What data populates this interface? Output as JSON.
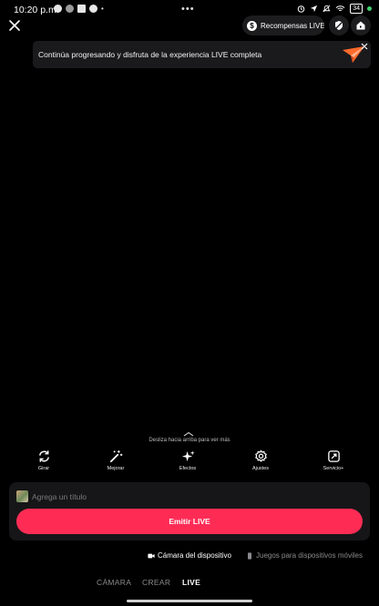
{
  "status_bar": {
    "time": "10:20 p.m.",
    "more_dots": "•••",
    "battery": "34"
  },
  "header": {
    "rewards_label": "Recompensas LIVE...",
    "coin_glyph": "$"
  },
  "banner": {
    "text": "Continúa progresando y disfruta de la experiencia LIVE completa"
  },
  "swipe_hint": "Desliza hacia arriba para ver más",
  "tools": [
    {
      "label": "Girar",
      "icon": "flip-camera-icon"
    },
    {
      "label": "Mejorar",
      "icon": "enhance-wand-icon"
    },
    {
      "label": "Efectos",
      "icon": "effects-sparkle-icon"
    },
    {
      "label": "Ajustes",
      "icon": "settings-gear-icon"
    },
    {
      "label": "Servicio+",
      "icon": "service-plus-icon"
    }
  ],
  "title_field": {
    "placeholder": "Agrega un título",
    "value": ""
  },
  "go_live_button": "Emitir LIVE",
  "sources": {
    "device_camera": "Cámara del dispositivo",
    "mobile_games": "Juegos para dispositivos móviles"
  },
  "modes": {
    "camera": "CÁMARA",
    "create": "CREAR",
    "live": "LIVE",
    "selected": "LIVE"
  },
  "colors": {
    "accent": "#fe2c55",
    "background": "#000000",
    "panel": "#161618"
  }
}
